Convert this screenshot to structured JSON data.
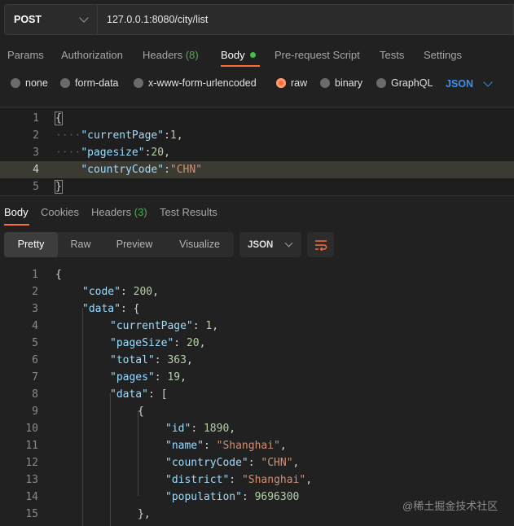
{
  "request": {
    "method": "POST",
    "url": "127.0.0.1:8080/city/list"
  },
  "request_tabs": {
    "params": "Params",
    "authorization": "Authorization",
    "headers": "Headers",
    "headers_count": "(8)",
    "body": "Body",
    "pre_request_script": "Pre-request Script",
    "tests": "Tests",
    "settings": "Settings"
  },
  "body_types": {
    "none": "none",
    "form_data": "form-data",
    "urlencoded": "x-www-form-urlencoded",
    "raw": "raw",
    "binary": "binary",
    "graphql": "GraphQL",
    "format": "JSON",
    "selected": "raw"
  },
  "request_body": {
    "line_numbers": [
      "1",
      "2",
      "3",
      "4",
      "5"
    ],
    "open_brace": "{",
    "close_brace": "}",
    "fields": [
      {
        "key": "\"currentPage\"",
        "colon": ":",
        "value": "1",
        "trail": ","
      },
      {
        "key": "\"pagesize\"",
        "colon": ":",
        "value": "20",
        "trail": ","
      },
      {
        "key": "\"countryCode\"",
        "colon": ":",
        "value": "\"CHN\"",
        "trail": ""
      }
    ]
  },
  "response_tabs": {
    "body": "Body",
    "cookies": "Cookies",
    "headers": "Headers",
    "headers_count": "(3)",
    "test_results": "Test Results"
  },
  "view_modes": {
    "pretty": "Pretty",
    "raw": "Raw",
    "preview": "Preview",
    "visualize": "Visualize",
    "format": "JSON"
  },
  "response_body": {
    "line_numbers": [
      "1",
      "2",
      "3",
      "4",
      "5",
      "6",
      "7",
      "8",
      "9",
      "10",
      "11",
      "12",
      "13",
      "14",
      "15"
    ],
    "l1": "{",
    "l2_key": "\"code\"",
    "l2_sep": ": ",
    "l2_val": "200",
    "l2_trail": ",",
    "l3_key": "\"data\"",
    "l3_sep": ": ",
    "l3_trail": "{",
    "l4_key": "\"currentPage\"",
    "l4_sep": ": ",
    "l4_val": "1",
    "l4_trail": ",",
    "l5_key": "\"pageSize\"",
    "l5_sep": ": ",
    "l5_val": "20",
    "l5_trail": ",",
    "l6_key": "\"total\"",
    "l6_sep": ": ",
    "l6_val": "363",
    "l6_trail": ",",
    "l7_key": "\"pages\"",
    "l7_sep": ": ",
    "l7_val": "19",
    "l7_trail": ",",
    "l8_key": "\"data\"",
    "l8_sep": ": ",
    "l8_trail": "[",
    "l9": "{",
    "l10_key": "\"id\"",
    "l10_sep": ": ",
    "l10_val": "1890",
    "l10_trail": ",",
    "l11_key": "\"name\"",
    "l11_sep": ": ",
    "l11_val": "\"Shanghai\"",
    "l11_trail": ",",
    "l12_key": "\"countryCode\"",
    "l12_sep": ": ",
    "l12_val": "\"CHN\"",
    "l12_trail": ",",
    "l13_key": "\"district\"",
    "l13_sep": ": ",
    "l13_val": "\"Shanghai\"",
    "l13_trail": ",",
    "l14_key": "\"population\"",
    "l14_sep": ": ",
    "l14_val": "9696300",
    "l15": "},"
  },
  "watermark": "@稀土掘金技术社区",
  "colors": {
    "accent": "#ff6c37",
    "success": "#43c143",
    "link": "#3d8fe8",
    "json_key": "#9cdcfe",
    "json_string": "#ce9178",
    "json_number": "#b5cea8"
  }
}
